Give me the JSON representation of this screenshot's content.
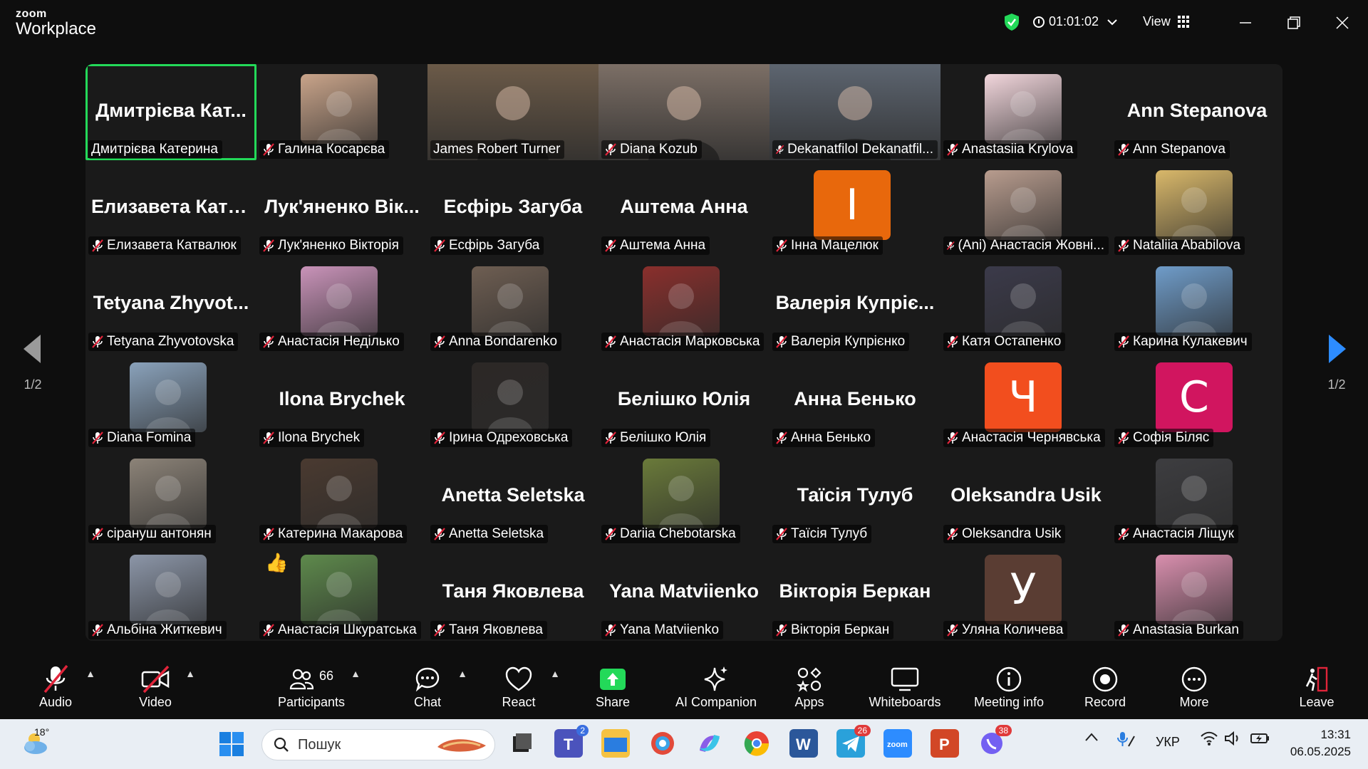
{
  "app": {
    "brand_top": "zoom",
    "brand_bottom": "Workplace"
  },
  "titlebar": {
    "timer": "01:01:02",
    "view_label": "View"
  },
  "colors": {
    "active_speaker": "#23d959",
    "accent_blue": "#2d8cff",
    "shield_green": "#23d959"
  },
  "pager": {
    "left_label": "1/2",
    "right_label": "1/2"
  },
  "tiles": [
    {
      "big": "Дмитрієва Кат...",
      "name": "Дмитрієва Катерина",
      "kind": "text",
      "active": true,
      "muted": false
    },
    {
      "name": "Галина Косарєва",
      "kind": "photo",
      "color": "#c9a48a",
      "muted": true
    },
    {
      "name": "James Robert Turner",
      "kind": "video",
      "color": "#6b5a48",
      "muted": false
    },
    {
      "name": "Diana Kozub",
      "kind": "video",
      "color": "#7c6f66",
      "muted": true
    },
    {
      "name": "Dekanatfilol Dekanatfil...",
      "kind": "video",
      "color": "#5d6570",
      "muted": true
    },
    {
      "name": "Anastasiia Krylova",
      "kind": "photo",
      "color": "#f2d6dc",
      "muted": true
    },
    {
      "big": "Ann Stepanova",
      "name": "Ann Stepanova",
      "kind": "text",
      "muted": true
    },
    {
      "big": "Елизавета Катв...",
      "name": "Елизавета Катвалюк",
      "kind": "text",
      "muted": true
    },
    {
      "big": "Лук'яненко Вік...",
      "name": "Лук'яненко Вікторія",
      "kind": "text",
      "muted": true
    },
    {
      "big": "Есфірь Загуба",
      "name": "Есфірь Загуба",
      "kind": "text",
      "muted": true
    },
    {
      "big": "Аштема Анна",
      "name": "Аштема Анна",
      "kind": "text",
      "muted": true
    },
    {
      "name": "Інна Мацелюк",
      "kind": "letter",
      "letter": "І",
      "color": "#e8680c",
      "muted": true
    },
    {
      "name": "(Ani) Анастасія Жовні...",
      "kind": "photo",
      "color": "#b89c8e",
      "muted": true
    },
    {
      "name": "Nataliia Ababilova",
      "kind": "photo",
      "color": "#d9b86a",
      "muted": true
    },
    {
      "big": "Tetyana Zhyvot...",
      "name": "Tetyana Zhyvotovska",
      "kind": "text",
      "muted": true
    },
    {
      "name": "Анастасія Неділько",
      "kind": "photo",
      "color": "#c993b9",
      "muted": true
    },
    {
      "name": "Anna Bondarenko",
      "kind": "photo",
      "color": "#6e5e52",
      "muted": true
    },
    {
      "name": "Анастасія Марковська",
      "kind": "photo",
      "color": "#8a2f2c",
      "muted": true
    },
    {
      "big": "Валерія Купріє...",
      "name": "Валерія Купрієнко",
      "kind": "text",
      "muted": true
    },
    {
      "name": "Катя Остапенко",
      "kind": "photo",
      "color": "#3b3a4a",
      "muted": true
    },
    {
      "name": "Карина Кулакевич",
      "kind": "photo",
      "color": "#6f9cc9",
      "muted": true
    },
    {
      "name": "Diana Fomina",
      "kind": "photo",
      "color": "#8aa2bb",
      "muted": true
    },
    {
      "big": "Ilona Brychek",
      "name": "Ilona Brychek",
      "kind": "text",
      "muted": true
    },
    {
      "name": "Ірина Одреховська",
      "kind": "photo",
      "color": "#2c2826",
      "muted": true
    },
    {
      "big": "Белішко Юлія",
      "name": "Белішко Юлія",
      "kind": "text",
      "muted": true
    },
    {
      "big": "Анна Бенько",
      "name": "Анна Бенько",
      "kind": "text",
      "muted": true
    },
    {
      "name": "Анастасія Чернявська",
      "kind": "letter",
      "letter": "Ч",
      "color": "#f24e1e",
      "muted": true
    },
    {
      "name": "Софія Біляс",
      "kind": "letter",
      "letter": "С",
      "color": "#d1155f",
      "muted": true
    },
    {
      "name": "сірануш антонян",
      "kind": "photo",
      "color": "#8c8378",
      "muted": true
    },
    {
      "name": "Катерина Макарова",
      "kind": "photo",
      "color": "#4a3a30",
      "muted": true
    },
    {
      "big": "Anetta Seletska",
      "name": "Anetta Seletska",
      "kind": "text",
      "muted": true
    },
    {
      "name": "Dariia Chebotarska",
      "kind": "photo",
      "color": "#6a7a3a",
      "muted": true
    },
    {
      "big": "Таїсія Тулуб",
      "name": "Таїсія Тулуб",
      "kind": "text",
      "muted": true
    },
    {
      "big": "Oleksandra Usik",
      "name": "Oleksandra Usik",
      "kind": "text",
      "muted": true
    },
    {
      "name": "Анастасія Ліщук",
      "kind": "photo",
      "color": "#3d3d40",
      "muted": true
    },
    {
      "name": "Альбіна Житкевич",
      "kind": "photo",
      "color": "#8c96a8",
      "muted": true
    },
    {
      "name": "Анастасія Шкуратська",
      "kind": "photo",
      "color": "#5e8a4c",
      "muted": true,
      "reaction": "👍"
    },
    {
      "big": "Таня Яковлева",
      "name": "Таня Яковлева",
      "kind": "text",
      "muted": true
    },
    {
      "big": "Yana Matviienko",
      "name": "Yana Matviienko",
      "kind": "text",
      "muted": true
    },
    {
      "big": "Вікторія Беркан",
      "name": "Вікторія Беркан",
      "kind": "text",
      "muted": true
    },
    {
      "name": "Уляна Количева",
      "kind": "letter",
      "letter": "У",
      "color": "#5a3d33",
      "muted": true
    },
    {
      "name": "Anastasia Burkan",
      "kind": "photo",
      "color": "#d98fae",
      "muted": true
    }
  ],
  "toolbar": {
    "audio": "Audio",
    "video": "Video",
    "participants": "Participants",
    "participants_count": "66",
    "chat": "Chat",
    "react": "React",
    "share": "Share",
    "ai": "AI Companion",
    "apps": "Apps",
    "whiteboards": "Whiteboards",
    "meeting_info": "Meeting info",
    "record": "Record",
    "more": "More",
    "leave": "Leave"
  },
  "taskbar": {
    "weather": "18°",
    "search_placeholder": "Пошук",
    "teams_badge": "2",
    "telegram_badge": "26",
    "viber_badge": "38",
    "lang": "УКР",
    "time": "13:31",
    "date": "06.05.2025"
  }
}
